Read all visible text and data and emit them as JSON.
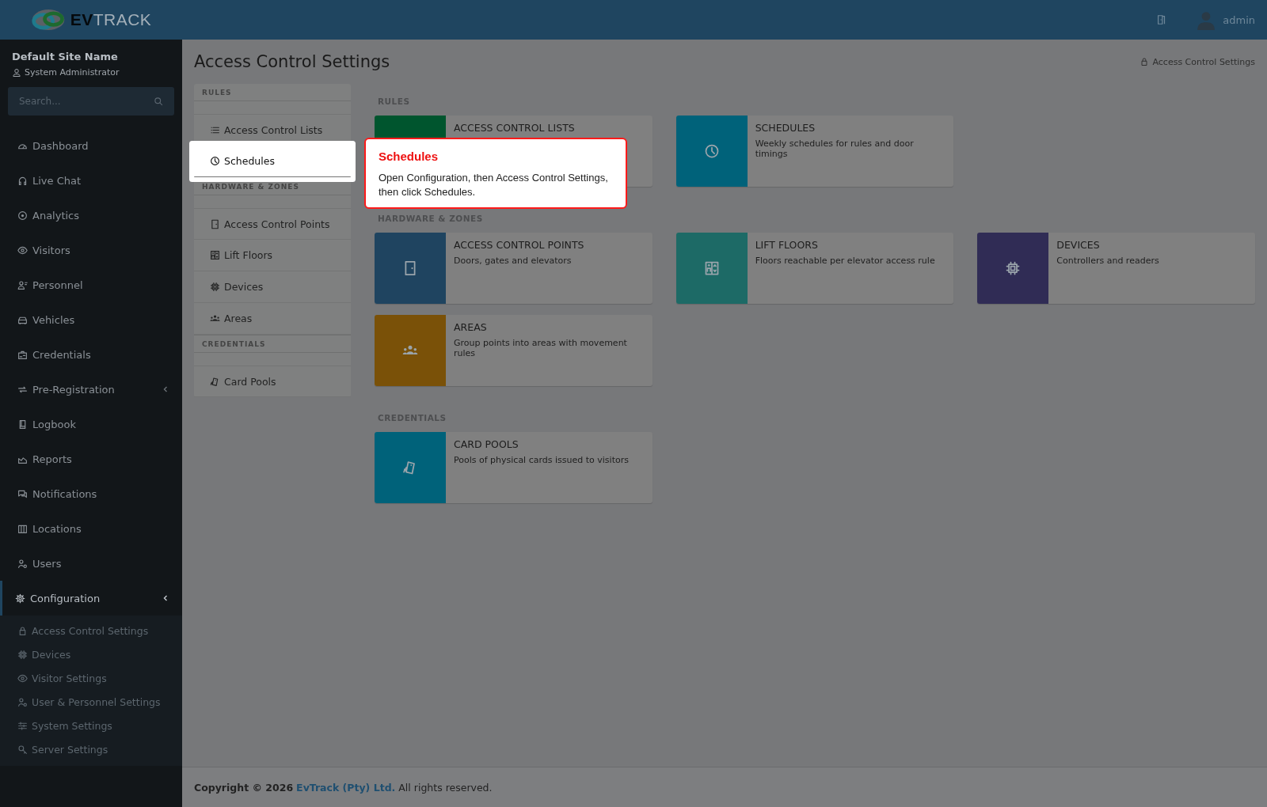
{
  "header": {
    "logo": "**EV**TRACK",
    "user": "admin"
  },
  "sidebar": {
    "site_name": "Default Site Name",
    "role": "System Administrator",
    "search": {
      "placeholder": "Search..."
    },
    "items": [
      {
        "label": "Dashboard",
        "selected": false
      },
      {
        "label": "Live Chat",
        "selected": false
      },
      {
        "label": "Analytics",
        "selected": false
      },
      {
        "label": "Visitors",
        "selected": false
      },
      {
        "label": "Personnel",
        "selected": false
      },
      {
        "label": "Vehicles",
        "selected": false
      },
      {
        "label": "Credentials",
        "selected": false
      },
      {
        "label": "Pre-Registration",
        "selected": false,
        "expanded": false
      },
      {
        "label": "Logbook",
        "selected": false
      },
      {
        "label": "Reports",
        "selected": false
      },
      {
        "label": "Notifications",
        "selected": false
      },
      {
        "label": "Locations",
        "selected": false
      },
      {
        "label": "Users",
        "selected": false
      },
      {
        "label": "Configuration",
        "selected": true,
        "expanded": true,
        "children": [
          {
            "label": "Access Control Settings"
          },
          {
            "label": "Devices"
          },
          {
            "label": "Visitor Settings"
          },
          {
            "label": "User & Personnel Settings"
          },
          {
            "label": "System Settings"
          },
          {
            "label": "Server Settings"
          }
        ]
      }
    ]
  },
  "page": {
    "title": "Access Control Settings",
    "breadcrumb": "Access Control Settings"
  },
  "subnav": [
    {
      "title": "RULES",
      "items": [
        {
          "label": "Access Control Lists",
          "selected": false
        },
        {
          "label": "Schedules",
          "selected": true
        }
      ]
    },
    {
      "title": "HARDWARE & ZONES",
      "items": [
        {
          "label": "Access Control Points",
          "selected": false
        },
        {
          "label": "Lift Floors",
          "selected": false
        },
        {
          "label": "Devices",
          "selected": false
        },
        {
          "label": "Areas",
          "selected": false
        }
      ]
    },
    {
      "title": "CREDENTIALS",
      "items": [
        {
          "label": "Card Pools",
          "selected": false
        }
      ]
    }
  ],
  "sections": [
    {
      "title": "RULES",
      "cards": [
        {
          "title": "ACCESS CONTROL LISTS",
          "color": "#00552e"
        },
        {
          "title": "SCHEDULES",
          "description": "Weekly schedules for rules and door timings",
          "color": "#00627a"
        }
      ]
    },
    {
      "title": "HARDWARE & ZONES",
      "cards": [
        {
          "title": "ACCESS CONTROL POINTS",
          "description": "Doors, gates and elevators",
          "color": "#1f4460"
        },
        {
          "title": "LIFT FLOORS",
          "description": "Floors reachable per elevator access rule",
          "color": "#1d6a66"
        },
        {
          "title": "DEVICES",
          "description": "Controllers and readers",
          "color": "#302c55"
        },
        {
          "title": "AREAS",
          "description": "Group points into areas with movement rules",
          "color": "#7a5108"
        }
      ]
    },
    {
      "title": "CREDENTIALS",
      "cards": [
        {
          "title": "CARD POOLS",
          "description": "Pools of physical cards issued to visitors",
          "color": "#00627a"
        }
      ]
    }
  ],
  "tooltip": {
    "title": "Schedules",
    "text": "Open Configuration, then Access Control Settings, then click Schedules."
  },
  "footer": {
    "copyright": "Copyright © 2026",
    "company": "EvTrack (Pty) Ltd.",
    "rights": "All rights reserved."
  }
}
